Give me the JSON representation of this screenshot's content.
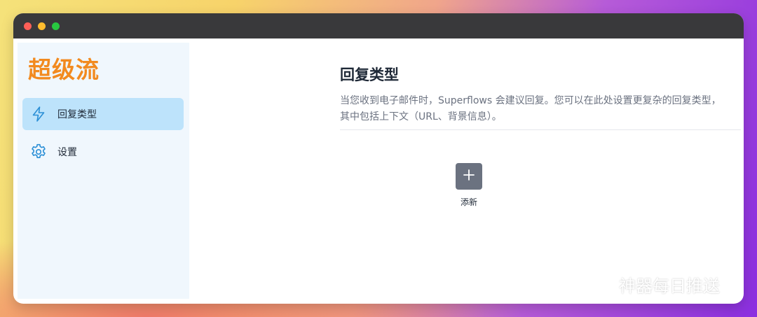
{
  "app": {
    "brand": "超级流"
  },
  "sidebar": {
    "items": [
      {
        "label": "回复类型",
        "icon": "lightning-icon",
        "active": true
      },
      {
        "label": "设置",
        "icon": "gear-icon",
        "active": false
      }
    ]
  },
  "main": {
    "title": "回复类型",
    "description": "当您收到电子邮件时，Superflows 会建议回复。您可以在此处设置更复杂的回复类型，其中包括上下文（URL、背景信息）。",
    "add_label": "添新"
  },
  "watermark": {
    "text": "神器每日推送",
    "icon": "wechat-icon"
  },
  "colors": {
    "brand": "#f28a1f",
    "active_nav": "#bde3fb",
    "sidebar_bg": "#f0f7fd",
    "add_button": "#6b7280",
    "titlebar": "#39393b"
  }
}
